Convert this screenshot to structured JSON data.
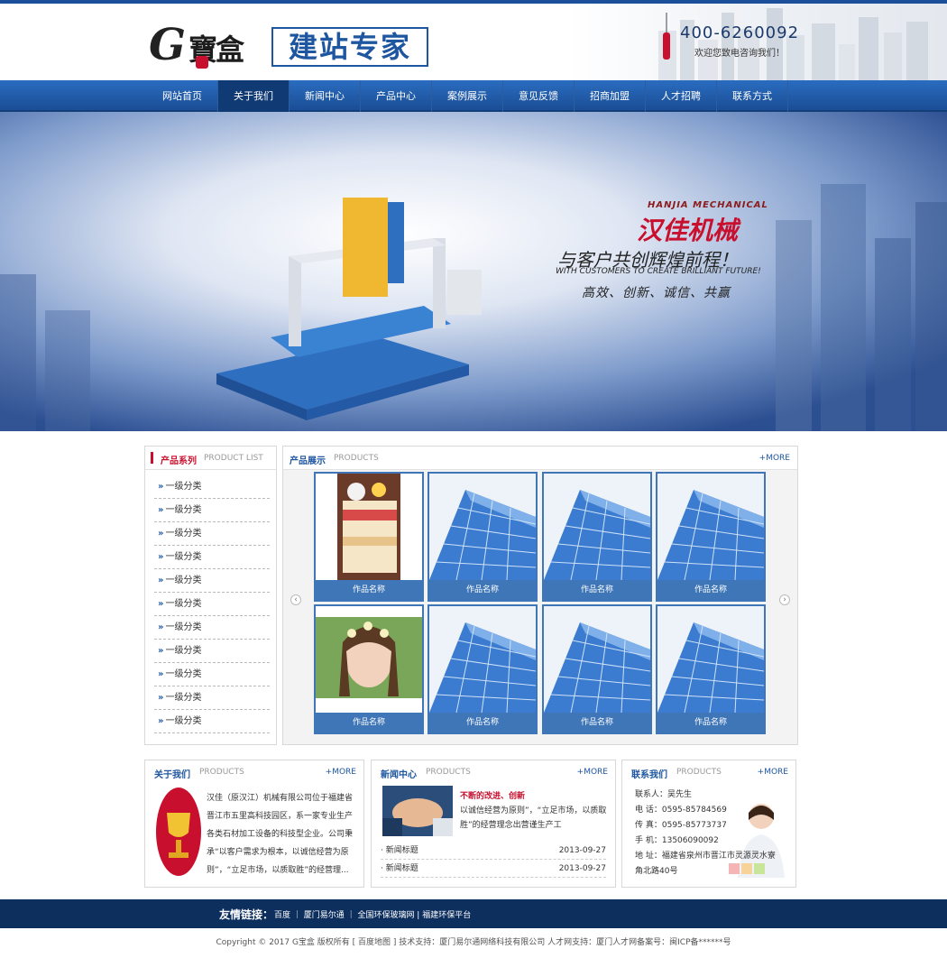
{
  "header": {
    "logo_letter": "G",
    "logo_brand": "寶盒",
    "logo_slogan": "建站专家",
    "phone": "400-6260092",
    "phone_sub": "欢迎您致电咨询我们！"
  },
  "nav": {
    "items": [
      {
        "label": "网站首页"
      },
      {
        "label": "关于我们"
      },
      {
        "label": "新闻中心"
      },
      {
        "label": "产品中心"
      },
      {
        "label": "案例展示"
      },
      {
        "label": "意见反馈"
      },
      {
        "label": "招商加盟"
      },
      {
        "label": "人才招聘"
      },
      {
        "label": "联系方式"
      }
    ]
  },
  "banner": {
    "en_brand": "HANJIA MECHANICAL",
    "cn_brand": "汉佳机械",
    "tagline": "与客户共创辉煌前程！",
    "tagline_en": "WITH CUSTOMERS TO CREATE BRILLIANT FUTURE!",
    "values": "高效、创新、诚信、共赢"
  },
  "product_list": {
    "title_cn": "产品系列",
    "title_en": "PRODUCT LIST",
    "items": [
      "一级分类",
      "一级分类",
      "一级分类",
      "一级分类",
      "一级分类",
      "一级分类",
      "一级分类",
      "一级分类",
      "一级分类",
      "一级分类",
      "一级分类"
    ]
  },
  "products": {
    "title_cn": "产品展示",
    "title_en": "PRODUCTS",
    "more": "+MORE",
    "items": [
      "作品名称",
      "作品名称",
      "作品名称",
      "作品名称",
      "作品名称",
      "作品名称",
      "作品名称",
      "作品名称"
    ]
  },
  "about": {
    "title_cn": "关于我们",
    "title_en": "PRODUCTS",
    "more": "+MORE",
    "text": "汉佳（原汉江）机械有限公司位于福建省晋江市五里高科技园区，系一家专业生产各类石材加工设备的科技型企业。公司秉承“以客户需求为根本，以诚信经营为原则”，“立足市场，以质取胜”的经营理..."
  },
  "news": {
    "title_cn": "新闻中心",
    "title_en": "PRODUCTS",
    "more": "+MORE",
    "feature_title": "不断的改进、创新",
    "feature_text": "以诚信经营为原则”，“立足市场，以质取胜”的经营理念出营谨生产工",
    "items": [
      {
        "title": "· 新闻标题",
        "date": "2013-09-27"
      },
      {
        "title": "· 新闻标题",
        "date": "2013-09-27"
      }
    ]
  },
  "contact": {
    "title_cn": "联系我们",
    "title_en": "PRODUCTS",
    "more": "+MORE",
    "person": "联系人：吴先生",
    "tel": "电 话：0595-85784569",
    "fax": "传 真：0595-85773737",
    "mobile": "手 机：13506090092",
    "address": "地 址：福建省泉州市晋江市灵源灵水寮角北路40号"
  },
  "footer": {
    "links_title": "友情链接：",
    "links": "百度 ｜ 厦门易尔通 ｜ 全国环保玻璃网 | 福建环保平台",
    "copyright": "Copyright © 2017 G宝盒 版权所有 [ 百度地图 ] 技术支持：厦门易尔通网络科技有限公司 人才网支持：厦门人才网备案号：闽ICP备******号"
  },
  "colors": {
    "primary": "#1e56a0",
    "accent": "#c8102e",
    "footer": "#0d2f5e"
  }
}
